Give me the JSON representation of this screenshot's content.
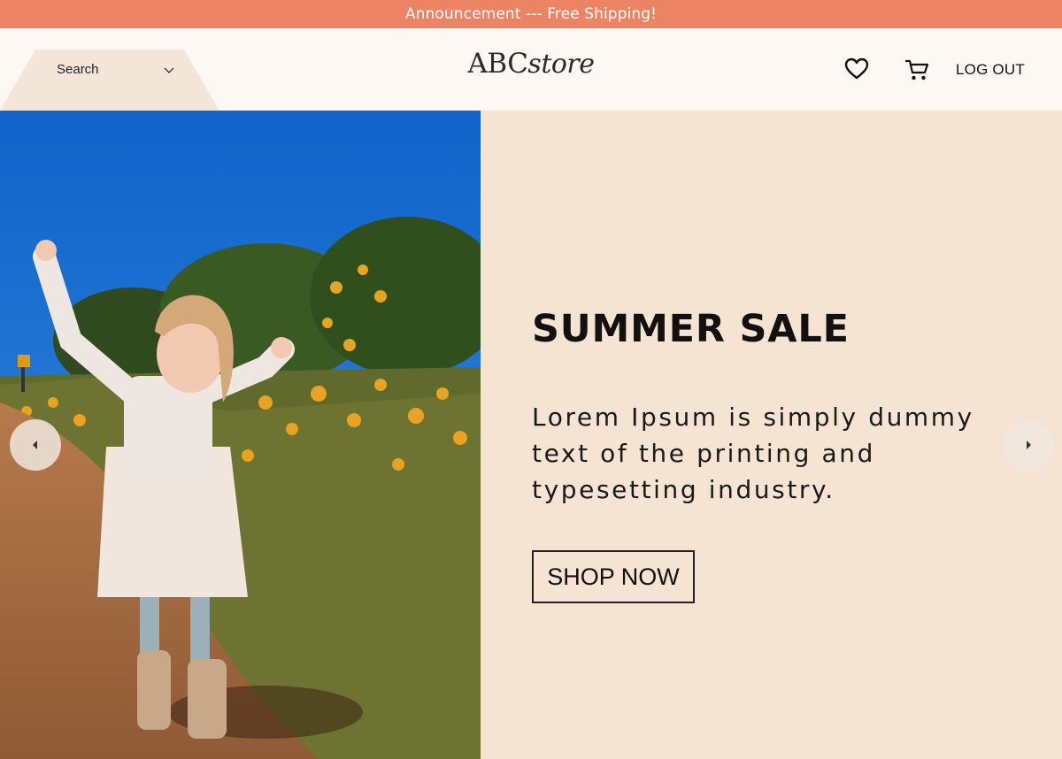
{
  "announcement": {
    "text": "Announcement --- Free Shipping!"
  },
  "header": {
    "search_label": "Search",
    "logo_abc": "ABC",
    "logo_store": "store",
    "wishlist_icon": "heart-icon",
    "cart_icon": "cart-icon",
    "logout_label": "LOG OUT"
  },
  "hero": {
    "headline": "SUMMER SALE",
    "body": "Lorem Ipsum is simply dummy text of the printing and typesetting industry.",
    "cta_label": "SHOP NOW",
    "prev_icon": "arrow-left-icon",
    "next_icon": "arrow-right-icon"
  },
  "colors": {
    "announcement_bg": "#ec8464",
    "header_bg": "#fdf8f3",
    "panel_bg": "#f5e4d1",
    "search_bg": "#f3e6d9"
  }
}
